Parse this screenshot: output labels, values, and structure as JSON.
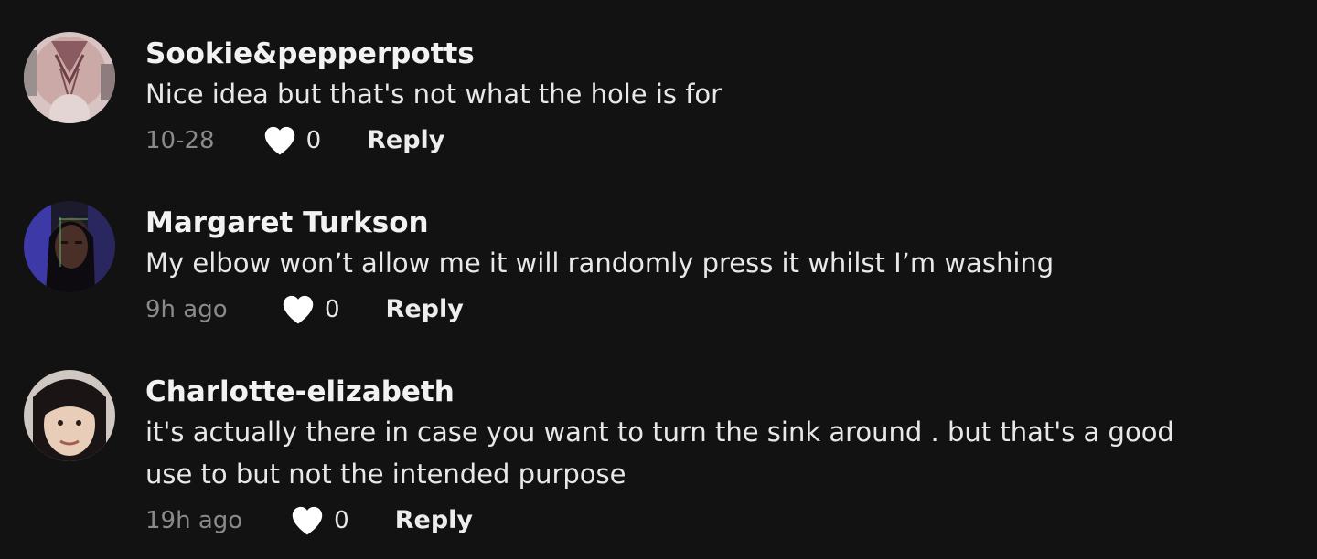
{
  "comments": [
    {
      "username": "Sookie&pepperpotts",
      "text": "Nice idea but that's not what the hole is for",
      "time": "10-28",
      "likes": "0",
      "reply": "Reply",
      "avatar_icon": "user-avatar-1"
    },
    {
      "username": "Margaret Turkson",
      "text": "My elbow won’t allow me it will randomly press it whilst I’m washing",
      "time": "9h ago",
      "likes": "0",
      "reply": "Reply",
      "avatar_icon": "user-avatar-2"
    },
    {
      "username": "Charlotte-elizabeth",
      "text": "it's actually there in case you want to turn the sink around . but that's a good use to but not the intended purpose",
      "time": "19h ago",
      "likes": "0",
      "reply": "Reply",
      "avatar_icon": "user-avatar-3"
    }
  ],
  "colors": {
    "background": "#121212",
    "username": "#f2f2f2",
    "meta_gray": "#8a8a8a",
    "heart": "#ffffff"
  }
}
